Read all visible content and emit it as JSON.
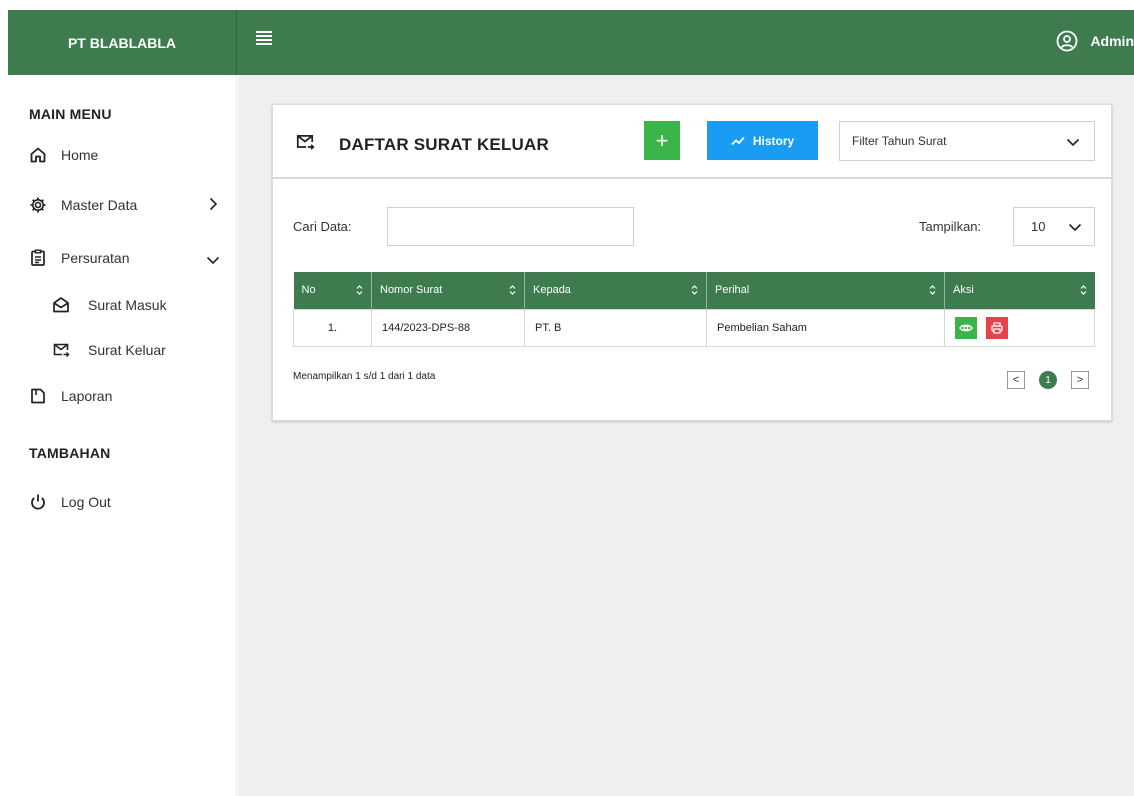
{
  "header": {
    "brand": "PT BLABLABLA",
    "user_name": "Admin"
  },
  "sidebar": {
    "main_menu_title": "MAIN MENU",
    "items": [
      {
        "label": "Home",
        "icon": "home-icon"
      },
      {
        "label": "Master Data",
        "icon": "gear-icon"
      },
      {
        "label": "Persuratan",
        "icon": "clipboard-icon"
      },
      {
        "label": "Surat Masuk",
        "icon": "envelope-open-icon"
      },
      {
        "label": "Surat Keluar",
        "icon": "mail-send-icon"
      },
      {
        "label": "Laporan",
        "icon": "document-icon"
      }
    ],
    "extra_title": "TAMBAHAN",
    "logout_label": "Log Out"
  },
  "card": {
    "title": "DAFTAR SURAT KELUAR",
    "add_label": "+",
    "history_label": "History",
    "filter_placeholder": "Filter Tahun Surat",
    "search_label": "Cari Data:",
    "show_label": "Tampilkan:",
    "show_value": "10"
  },
  "table": {
    "columns": [
      "No",
      "Nomor Surat",
      "Kepada",
      "Perihal",
      "Aksi"
    ],
    "rows": [
      {
        "no": "1.",
        "nomor": "144/2023-DPS-88",
        "kepada": "PT. B",
        "perihal": "Pembelian Saham"
      }
    ]
  },
  "footer": {
    "info": "Menampilkan 1 s/d 1 dari 1 data",
    "current_page": "1",
    "prev": "<",
    "next": ">"
  },
  "colors": {
    "primary_green": "#3e7b4f",
    "add_green": "#3bb54a",
    "history_blue": "#1a9cf2",
    "print_red": "#e5434c"
  }
}
